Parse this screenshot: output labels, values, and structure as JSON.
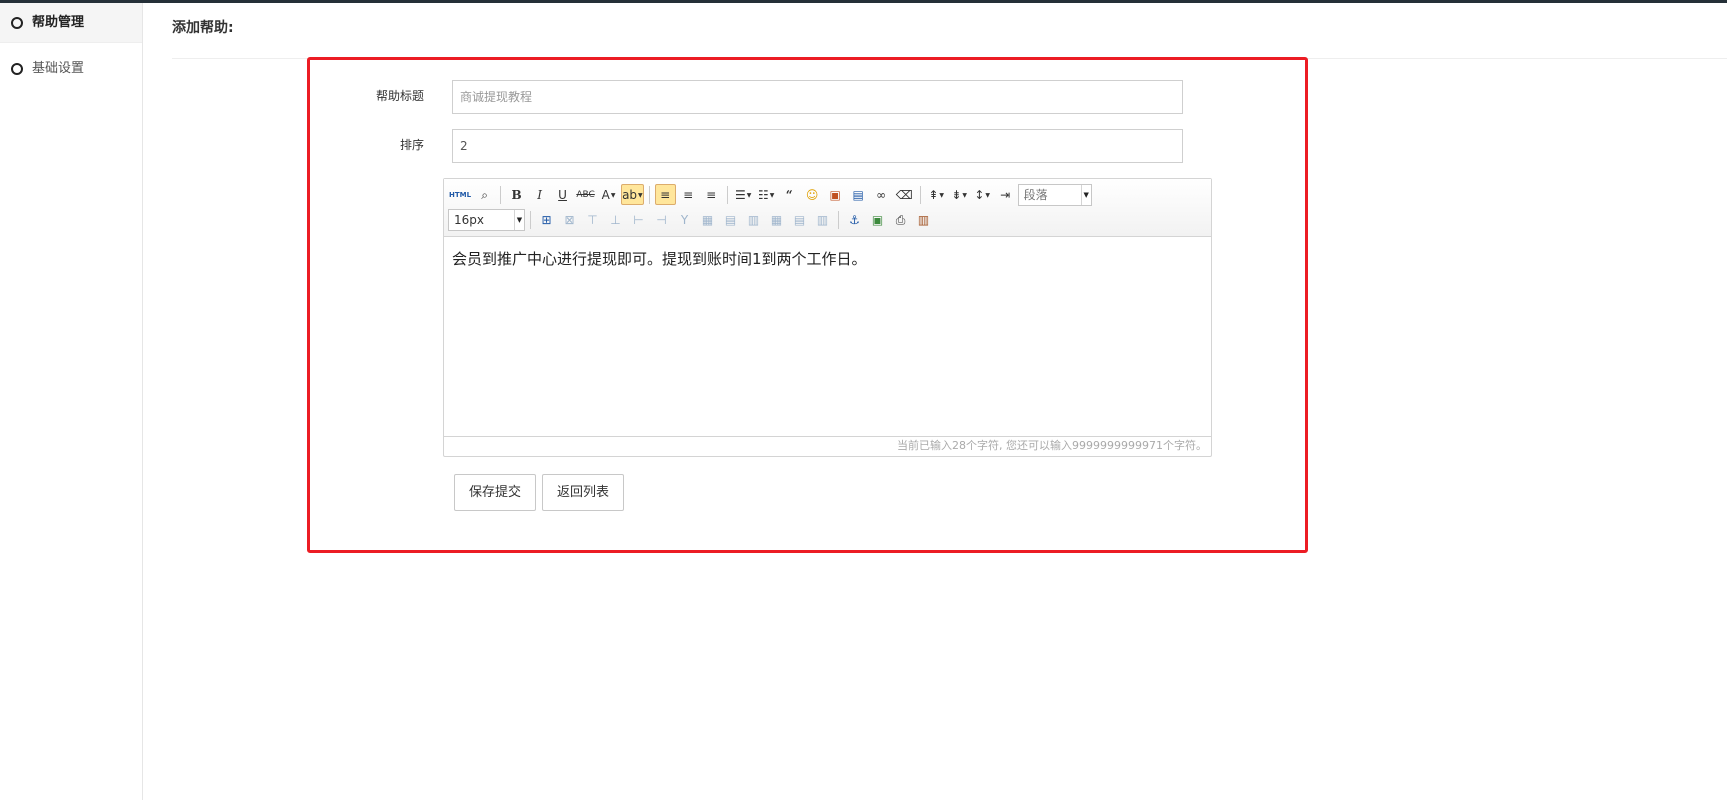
{
  "sidebar": {
    "items": [
      {
        "label": "帮助管理",
        "active": true
      },
      {
        "label": "基础设置",
        "active": false
      }
    ]
  },
  "header": {
    "title": "添加帮助:"
  },
  "form": {
    "title_label": "帮助标题",
    "title_value": "",
    "title_placeholder": "商诚提现教程",
    "sort_label": "排序",
    "sort_value": "2"
  },
  "editor": {
    "toolbar_row1": [
      "HTML",
      "search-icon",
      "B",
      "I",
      "U",
      "ABC",
      "A",
      "highlight-icon",
      "align-left-icon",
      "align-center-icon",
      "align-right-icon",
      "ordered-list-icon",
      "unordered-list-icon",
      "quote-icon",
      "emoticon-icon",
      "image-icon",
      "video-icon",
      "link-icon",
      "eraser-icon",
      "row-spacing-top-icon",
      "row-spacing-bottom-icon",
      "line-height-icon",
      "indent-icon"
    ],
    "paragraph_select": "段落",
    "font_size_select": "16px",
    "toolbar_row2": [
      "table-icon",
      "delete-table-icon",
      "insert-row-icon",
      "delete-row-icon",
      "insert-col-icon",
      "delete-col-icon",
      "merge-cells-icon",
      "split-cells-icon",
      "split-rows-icon",
      "split-cols-icon",
      "table-props-icon",
      "cell-props-icon",
      "col-width-icon",
      "anchor-icon",
      "media-icon",
      "print-icon",
      "paste-icon"
    ],
    "content": "会员到推广中心进行提现即可。提现到账时间1到两个工作日。",
    "status": "当前已输入28个字符, 您还可以输入9999999999971个字符。"
  },
  "buttons": {
    "save_label": "保存提交",
    "back_label": "返回列表"
  },
  "colors": {
    "highlight_border": "#ec1c24",
    "topbar": "#253038",
    "active_tool": "#ffe69b"
  }
}
